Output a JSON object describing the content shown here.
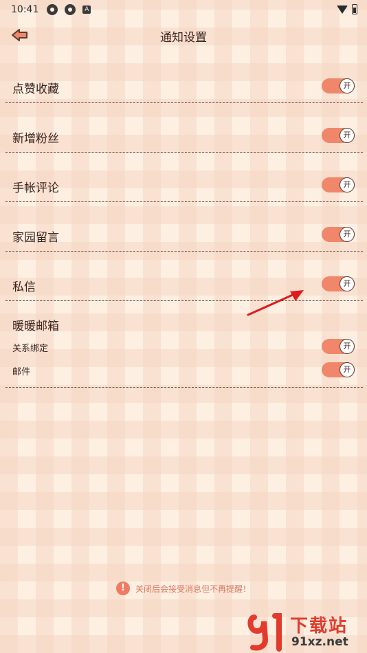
{
  "status": {
    "time": "10:41"
  },
  "header": {
    "title": "通知设置"
  },
  "settings": [
    {
      "label": "点赞收藏",
      "toggle": "开",
      "on": true
    },
    {
      "label": "新增粉丝",
      "toggle": "开",
      "on": true
    },
    {
      "label": "手帐评论",
      "toggle": "开",
      "on": true
    },
    {
      "label": "家园留言",
      "toggle": "开",
      "on": true
    },
    {
      "label": "私信",
      "toggle": "开",
      "on": true
    }
  ],
  "mailbox": {
    "title": "暖暖邮箱",
    "items": [
      {
        "label": "关系绑定",
        "toggle": "开",
        "on": true
      },
      {
        "label": "邮件",
        "toggle": "开",
        "on": true
      }
    ]
  },
  "notice": {
    "icon": "!",
    "text": "关闭后会接受消息但不再提醒！"
  },
  "watermark": {
    "title": "下载站",
    "url": "91xz.net"
  },
  "colors": {
    "accent": "#f0866a",
    "text": "#3a2420",
    "background": "#fdf0e2",
    "arrow": "#e01b1b"
  }
}
